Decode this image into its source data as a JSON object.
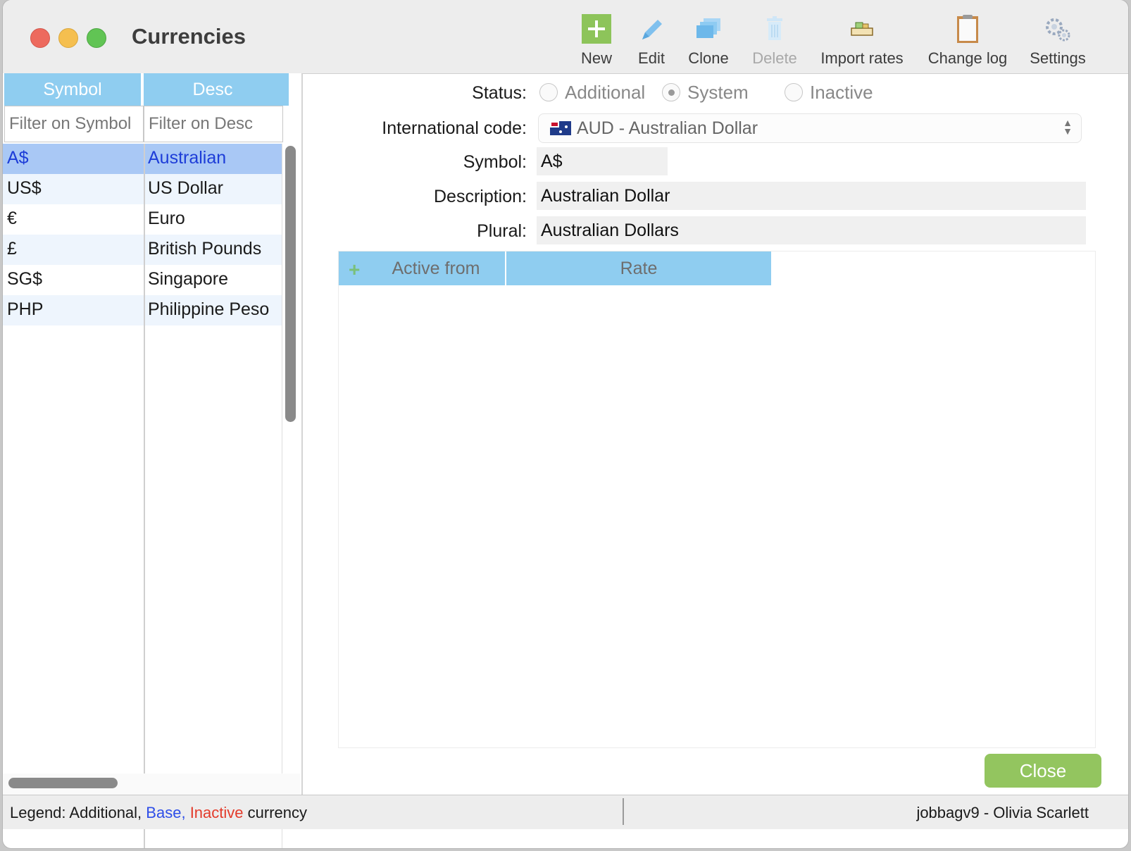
{
  "window": {
    "title": "Currencies"
  },
  "toolbar": [
    {
      "label": "New",
      "icon": "plus-icon",
      "enabled": true
    },
    {
      "label": "Edit",
      "icon": "pencil-icon",
      "enabled": true
    },
    {
      "label": "Clone",
      "icon": "clone-icon",
      "enabled": true
    },
    {
      "label": "Delete",
      "icon": "trash-icon",
      "enabled": false
    },
    {
      "label": "Import rates",
      "icon": "import-icon",
      "enabled": true
    },
    {
      "label": "Change log",
      "icon": "clipboard-icon",
      "enabled": true
    },
    {
      "label": "Settings",
      "icon": "gears-icon",
      "enabled": true
    }
  ],
  "list": {
    "columns": [
      "Symbol",
      "Desc"
    ],
    "filters": [
      "Filter on Symbol",
      "Filter on Desc"
    ],
    "rows": [
      {
        "symbol": "A$",
        "desc": "Australian"
      },
      {
        "symbol": "US$",
        "desc": "US Dollar"
      },
      {
        "symbol": "€",
        "desc": "Euro"
      },
      {
        "symbol": "£",
        "desc": "British Pounds"
      },
      {
        "symbol": "SG$",
        "desc": "Singapore"
      },
      {
        "symbol": "PHP",
        "desc": "Philippine Peso"
      }
    ],
    "selected_index": 0
  },
  "form": {
    "status_label": "Status:",
    "status_options": [
      "Additional",
      "System",
      "Inactive"
    ],
    "status_selected": "System",
    "intl_code_label": "International code:",
    "intl_code_value": "AUD - Australian Dollar",
    "symbol_label": "Symbol:",
    "symbol_value": "A$",
    "description_label": "Description:",
    "description_value": "Australian Dollar",
    "plural_label": "Plural:",
    "plural_value": "Australian Dollars"
  },
  "rates": {
    "columns": [
      "Active from",
      "Rate"
    ]
  },
  "close_label": "Close",
  "statusbar": {
    "legend_prefix": "Legend: Additional,",
    "legend_base": "Base,",
    "legend_inactive": "Inactive",
    "legend_suffix": "currency",
    "user": "jobbagv9 - Olivia Scarlett"
  },
  "colors": {
    "header_blue": "#8fcdf0",
    "selection_blue": "#a9c8f5",
    "base_text": "#2e4ee8",
    "inactive_text": "#e33b2b",
    "close_green": "#93c55f"
  }
}
